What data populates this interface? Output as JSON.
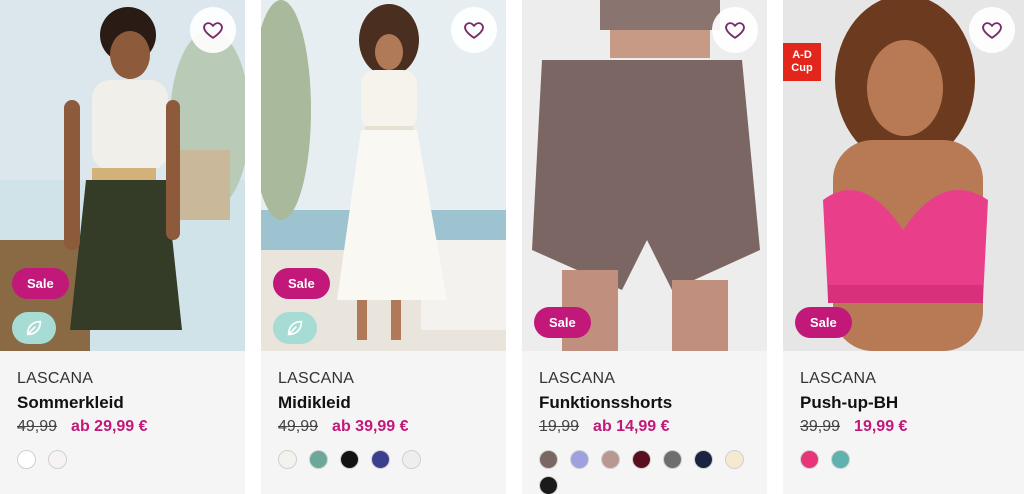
{
  "products": [
    {
      "brand": "LASCANA",
      "name": "Sommerkleid",
      "old_price": "49,99",
      "new_price": "ab 29,99 €",
      "badge": "Sale",
      "eco": true,
      "swatches": [
        "#ffffff",
        "#f7f2f4"
      ]
    },
    {
      "brand": "LASCANA",
      "name": "Midikleid",
      "old_price": "49,99",
      "new_price": "ab 39,99 €",
      "badge": "Sale",
      "eco": true,
      "swatches": [
        "#f2f2ef",
        "#6ba89a",
        "#121212",
        "#3c3f8e",
        "#eeeeee"
      ]
    },
    {
      "brand": "LASCANA",
      "name": "Funktionsshorts",
      "old_price": "19,99",
      "new_price": "ab 14,99 €",
      "badge": "Sale",
      "eco": false,
      "swatches": [
        "#7a6663",
        "#9ea0e0",
        "#b89992",
        "#5b0f1e",
        "#6e6e6e",
        "#1a2440",
        "#f5ead0",
        "#1a1a1a"
      ]
    },
    {
      "brand": "LASCANA",
      "name": "Push-up-BH",
      "old_price": "39,99",
      "new_price": "19,99 €",
      "badge": "Sale",
      "cup_badge": "A-D Cup",
      "eco": false,
      "swatches": [
        "#e8357a",
        "#5fb2ad"
      ]
    }
  ],
  "colors": {
    "accent": "#c2187a",
    "eco": "#a7dcd5",
    "cup_badge": "#e3261c"
  },
  "icons": {
    "favorite": "heart-outline-icon",
    "eco": "recycle-leaf-icon"
  }
}
